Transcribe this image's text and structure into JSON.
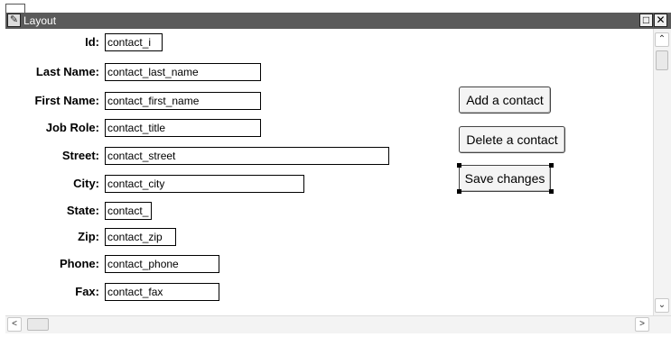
{
  "window": {
    "title": "Layout",
    "title_icon": "form-layout-icon",
    "restore_glyph": "□",
    "close_glyph": "✕"
  },
  "form": {
    "fields": [
      {
        "label": "Id:",
        "value": "contact_i"
      },
      {
        "label": "Last Name:",
        "value": "contact_last_name"
      },
      {
        "label": "First Name:",
        "value": "contact_first_name"
      },
      {
        "label": "Job Role:",
        "value": "contact_title"
      },
      {
        "label": "Street:",
        "value": "contact_street"
      },
      {
        "label": "City:",
        "value": "contact_city"
      },
      {
        "label": "State:",
        "value": "contact_"
      },
      {
        "label": "Zip:",
        "value": "contact_zip"
      },
      {
        "label": "Phone:",
        "value": "contact_phone"
      },
      {
        "label": "Fax:",
        "value": "contact_fax"
      }
    ]
  },
  "buttons": {
    "add": "Add a contact",
    "delete": "Delete a contact",
    "save": "Save changes"
  },
  "scrollbars": {
    "up_glyph": "⌃",
    "down_glyph": "⌄",
    "left_glyph": "<",
    "right_glyph": ">"
  }
}
